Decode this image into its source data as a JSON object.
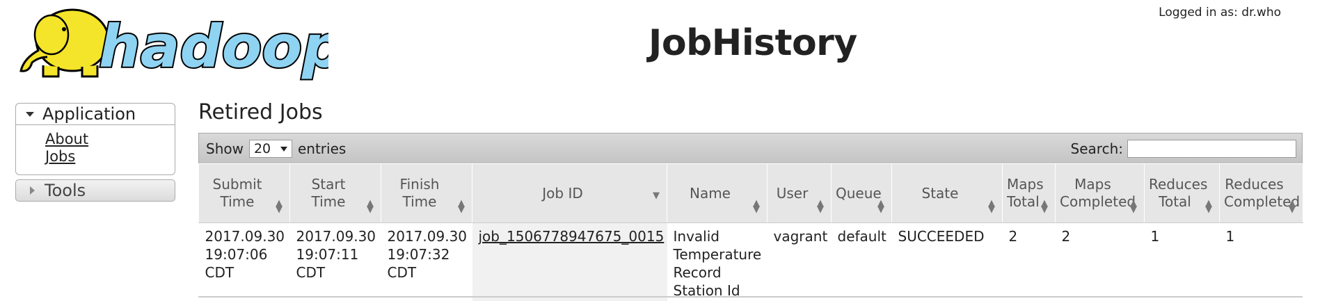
{
  "header": {
    "logo_text": "hadoop",
    "logged_in": "Logged in as: dr.who",
    "app_title": "JobHistory"
  },
  "sidebar": {
    "application": {
      "label": "Application",
      "items": [
        {
          "label": "About"
        },
        {
          "label": "Jobs"
        }
      ]
    },
    "tools": {
      "label": "Tools"
    }
  },
  "main": {
    "title": "Retired Jobs",
    "show_label": "Show",
    "entries_value": "20",
    "entries_label": "entries",
    "search_label": "Search:",
    "search_value": ""
  },
  "table": {
    "columns": [
      {
        "label": "Submit Time"
      },
      {
        "label": "Start Time"
      },
      {
        "label": "Finish Time"
      },
      {
        "label": "Job ID"
      },
      {
        "label": "Name"
      },
      {
        "label": "User"
      },
      {
        "label": "Queue"
      },
      {
        "label": "State"
      },
      {
        "label": "Maps Total"
      },
      {
        "label": "Maps Completed"
      },
      {
        "label": "Reduces Total"
      },
      {
        "label": "Reduces Completed"
      }
    ],
    "rows": [
      {
        "submit_time": "2017.09.30 19:07:06 CDT",
        "start_time": "2017.09.30 19:07:11 CDT",
        "finish_time": "2017.09.30 19:07:32 CDT",
        "job_id": "job_1506778947675_0015",
        "name": "Invalid Temperature Record Station Id",
        "user": "vagrant",
        "queue": "default",
        "state": "SUCCEEDED",
        "maps_total": "2",
        "maps_completed": "2",
        "reduces_total": "1",
        "reduces_completed": "1"
      }
    ]
  },
  "colors": {
    "elephant": "#f4e42a",
    "logo_text": "#8fd3f2",
    "logo_outline": "#000000"
  }
}
